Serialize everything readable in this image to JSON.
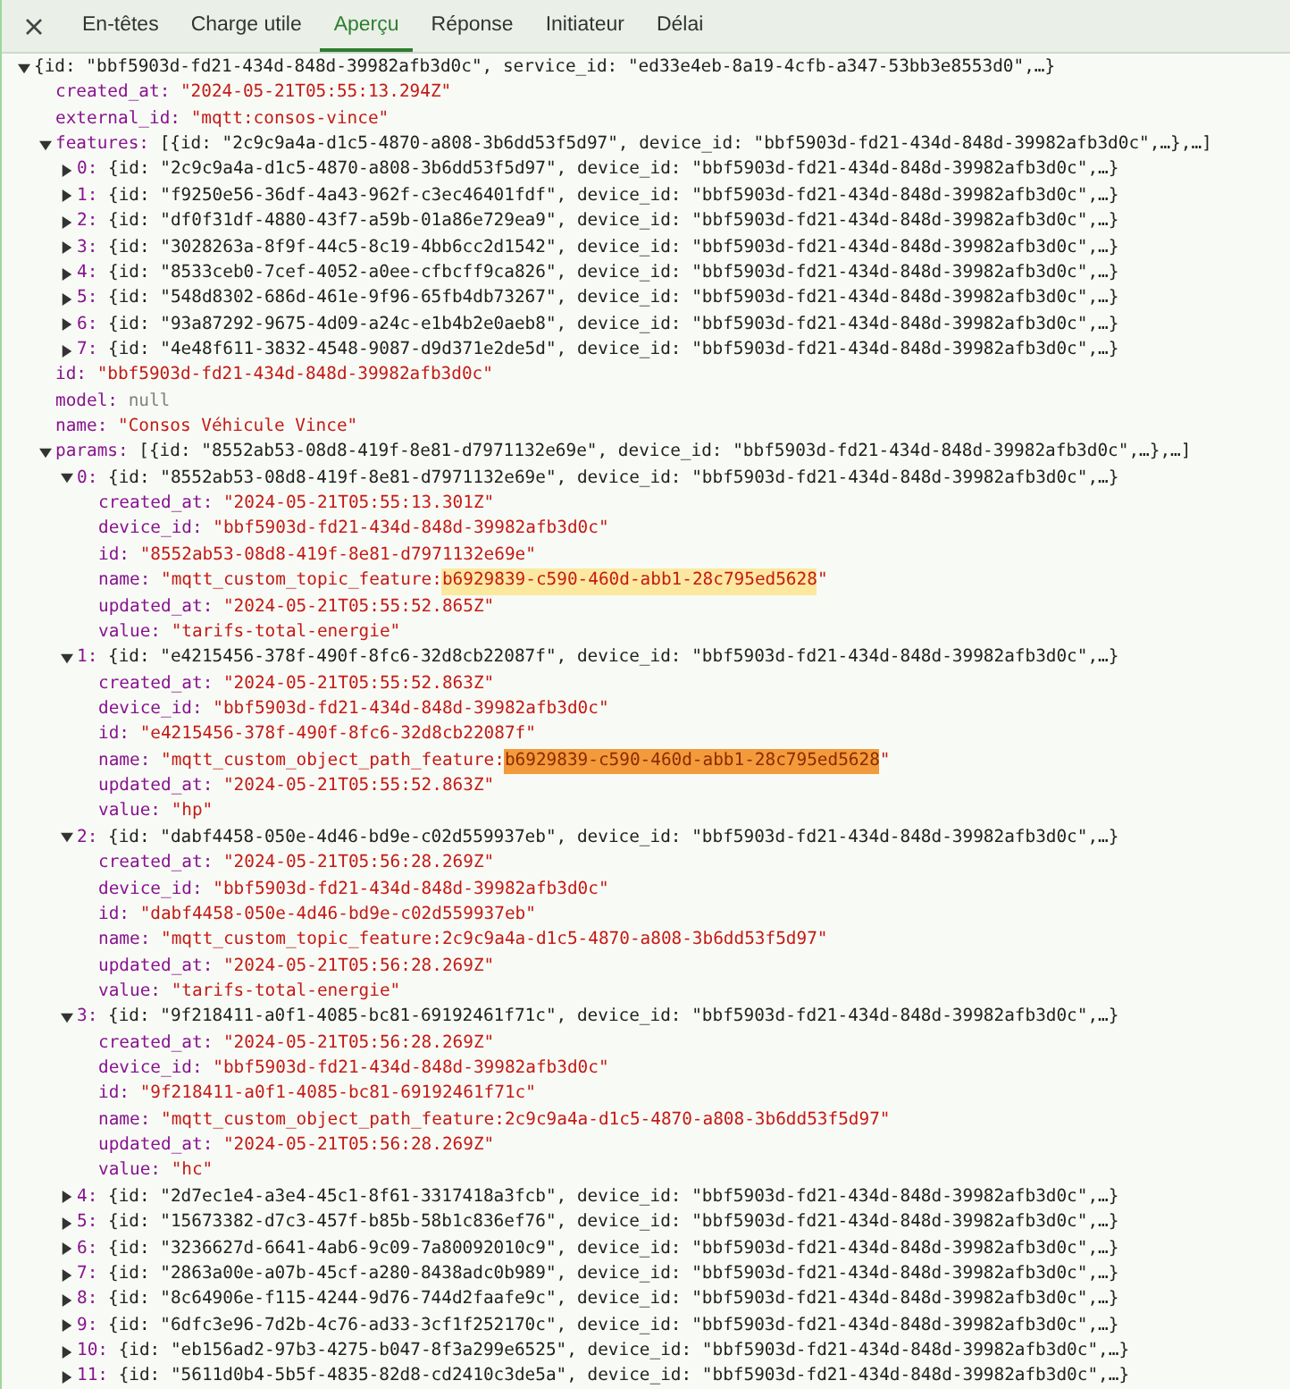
{
  "tabs": [
    {
      "label": "En-têtes",
      "selected": false
    },
    {
      "label": "Charge utile",
      "selected": false
    },
    {
      "label": "Aperçu",
      "selected": true
    },
    {
      "label": "Réponse",
      "selected": false
    },
    {
      "label": "Initiateur",
      "selected": false
    },
    {
      "label": "Délai",
      "selected": false
    }
  ],
  "tree": {
    "kind": "object",
    "expanded": true,
    "summary": "{id: \"bbf5903d-fd21-434d-848d-39982afb3d0c\", service_id: \"ed33e4eb-8a19-4cfb-a347-53bb3e8553d0\",…}",
    "children": [
      {
        "kind": "string",
        "key": "created_at:",
        "value": "\"2024-05-21T05:55:13.294Z\""
      },
      {
        "kind": "string",
        "key": "external_id:",
        "value": "\"mqtt:consos-vince\""
      },
      {
        "kind": "object",
        "key": "features:",
        "expanded": true,
        "summary": "[{id: \"2c9c9a4a-d1c5-4870-a808-3b6dd53f5d97\", device_id: \"bbf5903d-fd21-434d-848d-39982afb3d0c\",…},…]",
        "children": [
          {
            "kind": "object",
            "key": "0:",
            "expanded": false,
            "summary": "{id: \"2c9c9a4a-d1c5-4870-a808-3b6dd53f5d97\", device_id: \"bbf5903d-fd21-434d-848d-39982afb3d0c\",…}"
          },
          {
            "kind": "object",
            "key": "1:",
            "expanded": false,
            "summary": "{id: \"f9250e56-36df-4a43-962f-c3ec46401fdf\", device_id: \"bbf5903d-fd21-434d-848d-39982afb3d0c\",…}"
          },
          {
            "kind": "object",
            "key": "2:",
            "expanded": false,
            "summary": "{id: \"df0f31df-4880-43f7-a59b-01a86e729ea9\", device_id: \"bbf5903d-fd21-434d-848d-39982afb3d0c\",…}"
          },
          {
            "kind": "object",
            "key": "3:",
            "expanded": false,
            "summary": "{id: \"3028263a-8f9f-44c5-8c19-4bb6cc2d1542\", device_id: \"bbf5903d-fd21-434d-848d-39982afb3d0c\",…}"
          },
          {
            "kind": "object",
            "key": "4:",
            "expanded": false,
            "summary": "{id: \"8533ceb0-7cef-4052-a0ee-cfbcff9ca826\", device_id: \"bbf5903d-fd21-434d-848d-39982afb3d0c\",…}"
          },
          {
            "kind": "object",
            "key": "5:",
            "expanded": false,
            "summary": "{id: \"548d8302-686d-461e-9f96-65fb4db73267\", device_id: \"bbf5903d-fd21-434d-848d-39982afb3d0c\",…}"
          },
          {
            "kind": "object",
            "key": "6:",
            "expanded": false,
            "summary": "{id: \"93a87292-9675-4d09-a24c-e1b4b2e0aeb8\", device_id: \"bbf5903d-fd21-434d-848d-39982afb3d0c\",…}"
          },
          {
            "kind": "object",
            "key": "7:",
            "expanded": false,
            "summary": "{id: \"4e48f611-3832-4548-9087-d9d371e2de5d\", device_id: \"bbf5903d-fd21-434d-848d-39982afb3d0c\",…}"
          }
        ]
      },
      {
        "kind": "string",
        "key": "id:",
        "value": "\"bbf5903d-fd21-434d-848d-39982afb3d0c\""
      },
      {
        "kind": "null",
        "key": "model:",
        "value": "null"
      },
      {
        "kind": "string",
        "key": "name:",
        "value": "\"Consos Véhicule Vince\""
      },
      {
        "kind": "object",
        "key": "params:",
        "expanded": true,
        "summary": "[{id: \"8552ab53-08d8-419f-8e81-d7971132e69e\", device_id: \"bbf5903d-fd21-434d-848d-39982afb3d0c\",…},…]",
        "children": [
          {
            "kind": "object",
            "key": "0:",
            "expanded": true,
            "summary": "{id: \"8552ab53-08d8-419f-8e81-d7971132e69e\", device_id: \"bbf5903d-fd21-434d-848d-39982afb3d0c\",…}",
            "children": [
              {
                "kind": "string",
                "key": "created_at:",
                "value": "\"2024-05-21T05:55:13.301Z\""
              },
              {
                "kind": "string",
                "key": "device_id:",
                "value": "\"bbf5903d-fd21-434d-848d-39982afb3d0c\""
              },
              {
                "kind": "string",
                "key": "id:",
                "value": "\"8552ab53-08d8-419f-8e81-d7971132e69e\""
              },
              {
                "kind": "string",
                "key": "name:",
                "value": "\"mqtt_custom_topic_feature:",
                "match": {
                  "text": "b6929839-c590-460d-abb1-28c795ed5628",
                  "current": false
                },
                "value_end": "\""
              },
              {
                "kind": "string",
                "key": "updated_at:",
                "value": "\"2024-05-21T05:55:52.865Z\""
              },
              {
                "kind": "string",
                "key": "value:",
                "value": "\"tarifs-total-energie\""
              }
            ]
          },
          {
            "kind": "object",
            "key": "1:",
            "expanded": true,
            "summary": "{id: \"e4215456-378f-490f-8fc6-32d8cb22087f\", device_id: \"bbf5903d-fd21-434d-848d-39982afb3d0c\",…}",
            "children": [
              {
                "kind": "string",
                "key": "created_at:",
                "value": "\"2024-05-21T05:55:52.863Z\""
              },
              {
                "kind": "string",
                "key": "device_id:",
                "value": "\"bbf5903d-fd21-434d-848d-39982afb3d0c\""
              },
              {
                "kind": "string",
                "key": "id:",
                "value": "\"e4215456-378f-490f-8fc6-32d8cb22087f\""
              },
              {
                "kind": "string",
                "key": "name:",
                "value": "\"mqtt_custom_object_path_feature:",
                "match": {
                  "text": "b6929839-c590-460d-abb1-28c795ed5628",
                  "current": true
                },
                "value_end": "\""
              },
              {
                "kind": "string",
                "key": "updated_at:",
                "value": "\"2024-05-21T05:55:52.863Z\""
              },
              {
                "kind": "string",
                "key": "value:",
                "value": "\"hp\""
              }
            ]
          },
          {
            "kind": "object",
            "key": "2:",
            "expanded": true,
            "summary": "{id: \"dabf4458-050e-4d46-bd9e-c02d559937eb\", device_id: \"bbf5903d-fd21-434d-848d-39982afb3d0c\",…}",
            "children": [
              {
                "kind": "string",
                "key": "created_at:",
                "value": "\"2024-05-21T05:56:28.269Z\""
              },
              {
                "kind": "string",
                "key": "device_id:",
                "value": "\"bbf5903d-fd21-434d-848d-39982afb3d0c\""
              },
              {
                "kind": "string",
                "key": "id:",
                "value": "\"dabf4458-050e-4d46-bd9e-c02d559937eb\""
              },
              {
                "kind": "string",
                "key": "name:",
                "value": "\"mqtt_custom_topic_feature:2c9c9a4a-d1c5-4870-a808-3b6dd53f5d97\""
              },
              {
                "kind": "string",
                "key": "updated_at:",
                "value": "\"2024-05-21T05:56:28.269Z\""
              },
              {
                "kind": "string",
                "key": "value:",
                "value": "\"tarifs-total-energie\""
              }
            ]
          },
          {
            "kind": "object",
            "key": "3:",
            "expanded": true,
            "summary": "{id: \"9f218411-a0f1-4085-bc81-69192461f71c\", device_id: \"bbf5903d-fd21-434d-848d-39982afb3d0c\",…}",
            "children": [
              {
                "kind": "string",
                "key": "created_at:",
                "value": "\"2024-05-21T05:56:28.269Z\""
              },
              {
                "kind": "string",
                "key": "device_id:",
                "value": "\"bbf5903d-fd21-434d-848d-39982afb3d0c\""
              },
              {
                "kind": "string",
                "key": "id:",
                "value": "\"9f218411-a0f1-4085-bc81-69192461f71c\""
              },
              {
                "kind": "string",
                "key": "name:",
                "value": "\"mqtt_custom_object_path_feature:2c9c9a4a-d1c5-4870-a808-3b6dd53f5d97\""
              },
              {
                "kind": "string",
                "key": "updated_at:",
                "value": "\"2024-05-21T05:56:28.269Z\""
              },
              {
                "kind": "string",
                "key": "value:",
                "value": "\"hc\""
              }
            ]
          },
          {
            "kind": "object",
            "key": "4:",
            "expanded": false,
            "summary": "{id: \"2d7ec1e4-a3e4-45c1-8f61-3317418a3fcb\", device_id: \"bbf5903d-fd21-434d-848d-39982afb3d0c\",…}"
          },
          {
            "kind": "object",
            "key": "5:",
            "expanded": false,
            "summary": "{id: \"15673382-d7c3-457f-b85b-58b1c836ef76\", device_id: \"bbf5903d-fd21-434d-848d-39982afb3d0c\",…}"
          },
          {
            "kind": "object",
            "key": "6:",
            "expanded": false,
            "summary": "{id: \"3236627d-6641-4ab6-9c09-7a80092010c9\", device_id: \"bbf5903d-fd21-434d-848d-39982afb3d0c\",…}"
          },
          {
            "kind": "object",
            "key": "7:",
            "expanded": false,
            "summary": "{id: \"2863a00e-a07b-45cf-a280-8438adc0b989\", device_id: \"bbf5903d-fd21-434d-848d-39982afb3d0c\",…}"
          },
          {
            "kind": "object",
            "key": "8:",
            "expanded": false,
            "summary": "{id: \"8c64906e-f115-4244-9d76-744d2faafe9c\", device_id: \"bbf5903d-fd21-434d-848d-39982afb3d0c\",…}"
          },
          {
            "kind": "object",
            "key": "9:",
            "expanded": false,
            "summary": "{id: \"6dfc3e96-7d2b-4c76-ad33-3cf1f252170c\", device_id: \"bbf5903d-fd21-434d-848d-39982afb3d0c\",…}"
          },
          {
            "kind": "object",
            "key": "10:",
            "expanded": false,
            "summary": "{id: \"eb156ad2-97b3-4275-b047-8f3a299e6525\", device_id: \"bbf5903d-fd21-434d-848d-39982afb3d0c\",…}"
          },
          {
            "kind": "object",
            "key": "11:",
            "expanded": false,
            "summary": "{id: \"5611d0b4-5b5f-4835-82d8-cd2410c3de5a\", device_id: \"bbf5903d-fd21-434d-848d-39982afb3d0c\",…}"
          }
        ]
      }
    ]
  }
}
